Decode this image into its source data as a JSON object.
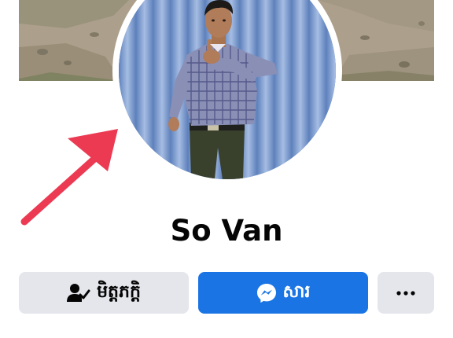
{
  "profile": {
    "name": "So Van"
  },
  "actions": {
    "friends_label": "មិត្តភក្តិ",
    "message_label": "សារ",
    "more_label": "…"
  },
  "icons": {
    "friends": "person-check-icon",
    "message": "messenger-icon",
    "more": "more-dots-icon",
    "annotation": "red-arrow-icon"
  },
  "colors": {
    "message_button": "#1b74e4",
    "secondary_button": "#e4e6eb",
    "annotation_arrow": "#ec3a53",
    "text": "#050505"
  }
}
